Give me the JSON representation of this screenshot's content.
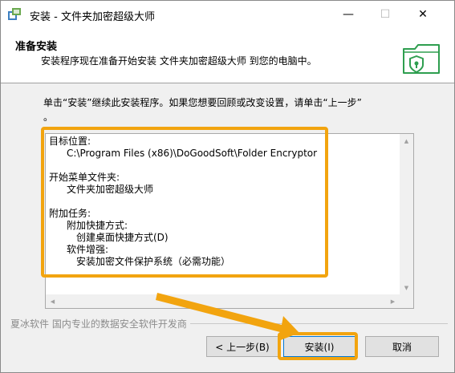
{
  "window": {
    "title": "安装 - 文件夹加密超级大师",
    "minimize_glyph": "—",
    "maximize_glyph": "☐",
    "close_glyph": "✕"
  },
  "header": {
    "title": "准备安装",
    "subtitle": "安装程序现在准备开始安装 文件夹加密超级大师 到您的电脑中。",
    "icon": "folder-shield-icon"
  },
  "instructions": {
    "line1": "单击“安装”继续此安装程序。如果您想要回顾或改变设置，请单击“上一步”",
    "line2": "。"
  },
  "memo": {
    "dest_label": "目标位置:",
    "dest_value": "C:\\Program Files (x86)\\DoGoodSoft\\Folder Encryptor",
    "startmenu_label": "开始菜单文件夹:",
    "startmenu_value": "文件夹加密超级大师",
    "tasks_label": "附加任务:",
    "shortcut_label": "附加快捷方式:",
    "shortcut_value": "创建桌面快捷方式(D)",
    "enhance_label": "软件增强:",
    "enhance_value": "安装加密文件保护系统（必需功能）"
  },
  "brand": "夏冰软件 国内专业的数据安全软件开发商",
  "buttons": {
    "back": "< 上一步(B)",
    "install": "安装(I)",
    "cancel": "取消"
  },
  "colors": {
    "highlight": "#f2a40f",
    "accent": "#0078d7",
    "icon_green": "#2e9e4f"
  }
}
